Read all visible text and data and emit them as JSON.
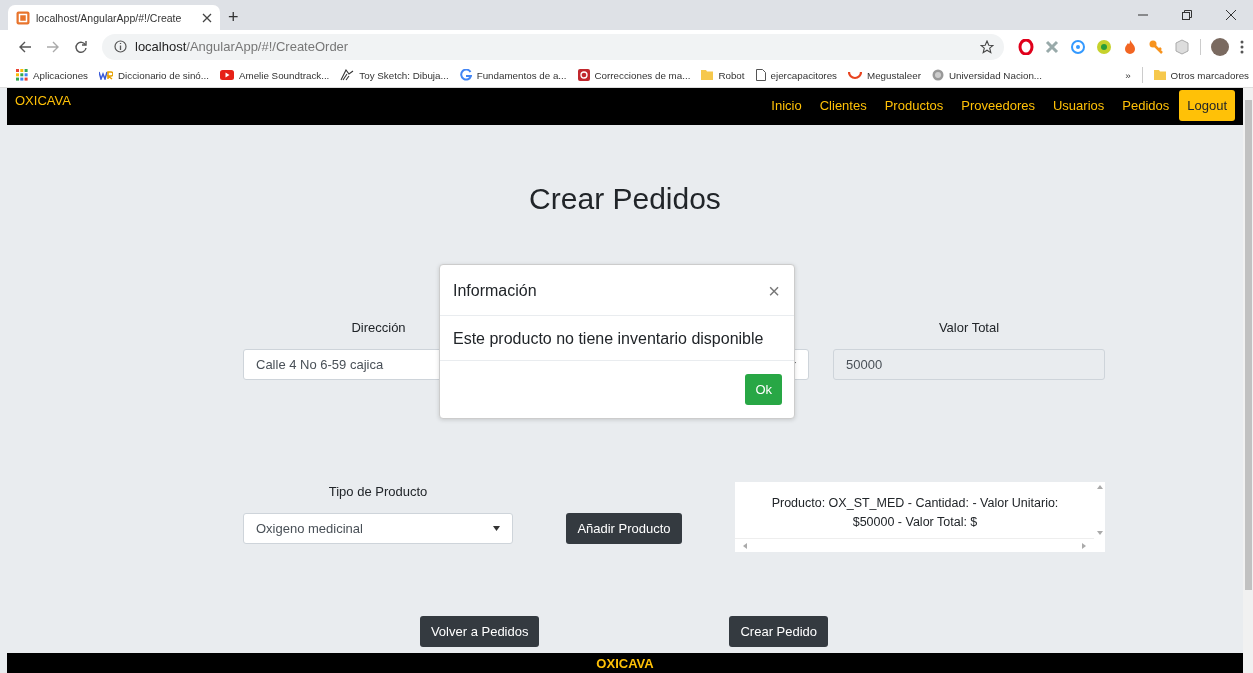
{
  "browser": {
    "tab_title": "localhost/AngularApp/#!/Create",
    "new_tab": "+",
    "url_host": "localhost",
    "url_path": "/AngularApp/#!/CreateOrder",
    "bookmarks": [
      {
        "label": "Aplicaciones",
        "kind": "apps"
      },
      {
        "label": "Diccionario de sinó...",
        "kind": "wr"
      },
      {
        "label": "Amelie Soundtrack...",
        "kind": "video"
      },
      {
        "label": "Toy Sketch: Dibuja...",
        "kind": "sketch"
      },
      {
        "label": "Fundamentos de a...",
        "kind": "g"
      },
      {
        "label": "Correcciones de ma...",
        "kind": "red"
      },
      {
        "label": "Robot",
        "kind": "folder"
      },
      {
        "label": "ejercapacitores",
        "kind": "page"
      },
      {
        "label": "Megustaleer",
        "kind": "smile"
      },
      {
        "label": "Universidad Nacion...",
        "kind": "seal"
      }
    ],
    "overflow": "»",
    "other_bookmarks": "Otros marcadores"
  },
  "navbar": {
    "brand": "OXICAVA",
    "links": [
      {
        "label": "Inicio"
      },
      {
        "label": "Clientes"
      },
      {
        "label": "Productos"
      },
      {
        "label": "Proveedores"
      },
      {
        "label": "Usuarios"
      },
      {
        "label": "Pedidos"
      }
    ],
    "logout": "Logout"
  },
  "page": {
    "title": "Crear Pedidos",
    "address": {
      "label": "Dirección",
      "value": "Calle 4 No 6-59 cajica"
    },
    "total": {
      "label": "Valor Total",
      "value": "50000",
      "disabled": true
    },
    "product_type": {
      "label": "Tipo de Producto",
      "value": "Oxigeno medicinal"
    },
    "add_button": "Añadir Producto",
    "product_list": "Producto: OX_ST_MED - Cantidad: - Valor Unitario: $50000 - Valor Total: $",
    "back_button": "Volver a Pedidos",
    "create_button": "Crear Pedido"
  },
  "modal": {
    "title": "Información",
    "close": "×",
    "message": "Este producto no tiene inventario disponible",
    "ok": "Ok"
  },
  "footer": {
    "brand": "OXICAVA"
  }
}
